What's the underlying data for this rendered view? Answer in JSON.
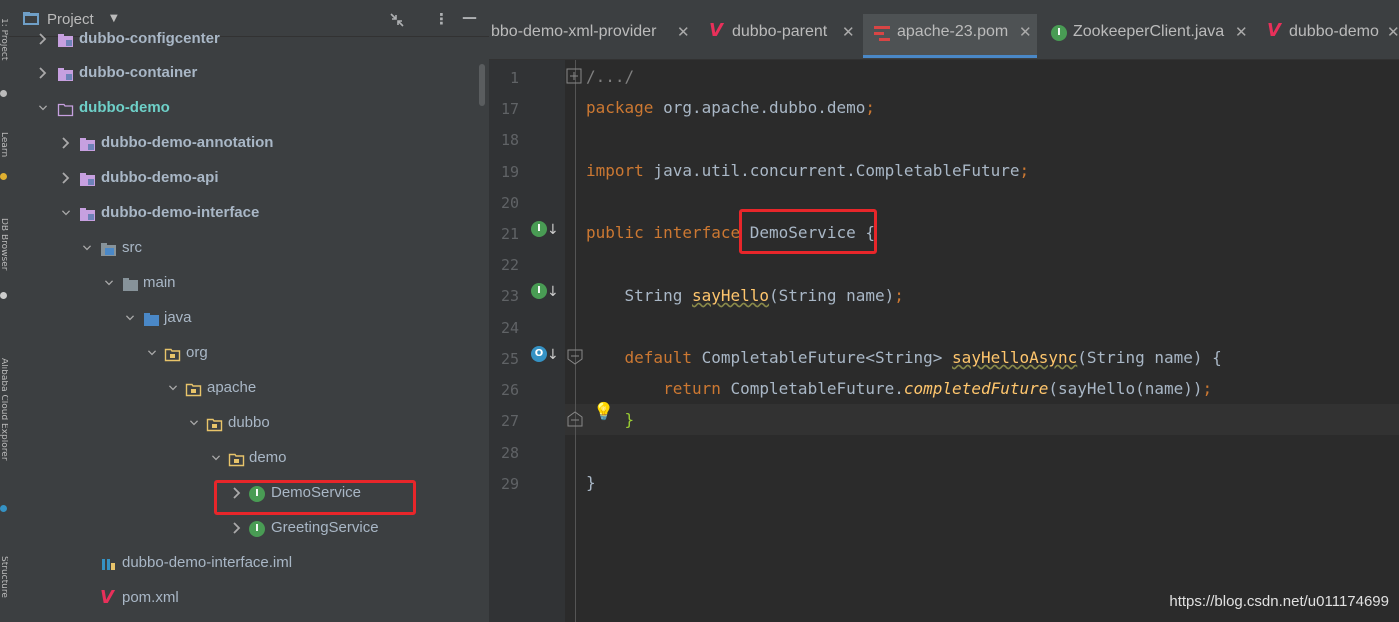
{
  "toolstrip": {
    "labels": [
      "1: Project",
      "Learn",
      "DB Browser",
      "Alibaba Cloud Explorer",
      "Structure"
    ]
  },
  "project_panel": {
    "title": "Project",
    "tree": [
      {
        "label": "dubbo-configcenter",
        "icon": "module-folder-icon"
      },
      {
        "label": "dubbo-container",
        "icon": "module-folder-icon"
      },
      {
        "label": "dubbo-demo",
        "icon": "folder-outline-icon"
      },
      {
        "label": "dubbo-demo-annotation",
        "icon": "module-folder-icon"
      },
      {
        "label": "dubbo-demo-api",
        "icon": "module-folder-icon"
      },
      {
        "label": "dubbo-demo-interface",
        "icon": "module-folder-icon"
      },
      {
        "label": "src",
        "icon": "source-folder-icon"
      },
      {
        "label": "main",
        "icon": "folder-icon"
      },
      {
        "label": "java",
        "icon": "source-root-icon"
      },
      {
        "label": "org",
        "icon": "package-icon"
      },
      {
        "label": "apache",
        "icon": "package-icon"
      },
      {
        "label": "dubbo",
        "icon": "package-icon"
      },
      {
        "label": "demo",
        "icon": "package-icon"
      },
      {
        "label": "DemoService",
        "icon": "interface-icon"
      },
      {
        "label": "GreetingService",
        "icon": "interface-icon"
      },
      {
        "label": "dubbo-demo-interface.iml",
        "icon": "iml-file-icon"
      },
      {
        "label": "pom.xml",
        "icon": "maven-icon"
      }
    ]
  },
  "tabs": [
    {
      "label": "bbo-demo-xml-provider",
      "icon": "none"
    },
    {
      "label": "dubbo-parent",
      "icon": "maven-icon"
    },
    {
      "label": "apache-23.pom",
      "icon": "pom-icon",
      "active": true
    },
    {
      "label": "ZookeeperClient.java",
      "icon": "interface-icon"
    },
    {
      "label": "dubbo-demo",
      "icon": "maven-icon"
    }
  ],
  "editor": {
    "line_numbers": [
      "1",
      "17",
      "18",
      "19",
      "20",
      "21",
      "22",
      "23",
      "24",
      "25",
      "26",
      "27",
      "28",
      "29"
    ],
    "lines": {
      "l1": "/.../",
      "l17_kw": "package",
      "l17_rest": " org.apache.dubbo.demo",
      "l17_semi": ";",
      "l19_kw": "import",
      "l19_rest": " java.util.concurrent.CompletableFuture",
      "l19_semi": ";",
      "l21_kw": "public interface ",
      "l21_name": "DemoService",
      "l21_brace": " {",
      "l23_type": "    String ",
      "l23_method": "sayHello",
      "l23_rest": "(String name)",
      "l23_semi": ";",
      "l25_kw": "    default ",
      "l25_type": "CompletableFuture<String> ",
      "l25_method": "sayHelloAsync",
      "l25_rest": "(String name) {",
      "l26_kw": "        return ",
      "l26_class": "CompletableFuture.",
      "l26_method": "completedFuture",
      "l26_rest": "(sayHello(name))",
      "l26_semi": ";",
      "l27": "    }",
      "l29": "}"
    }
  },
  "watermark": "https://blog.csdn.net/u011174699",
  "colors": {
    "keyword": "#cc7832",
    "method": "#ffc66d",
    "highlight_box": "#e8262a",
    "interface_icon": "#499c54"
  }
}
